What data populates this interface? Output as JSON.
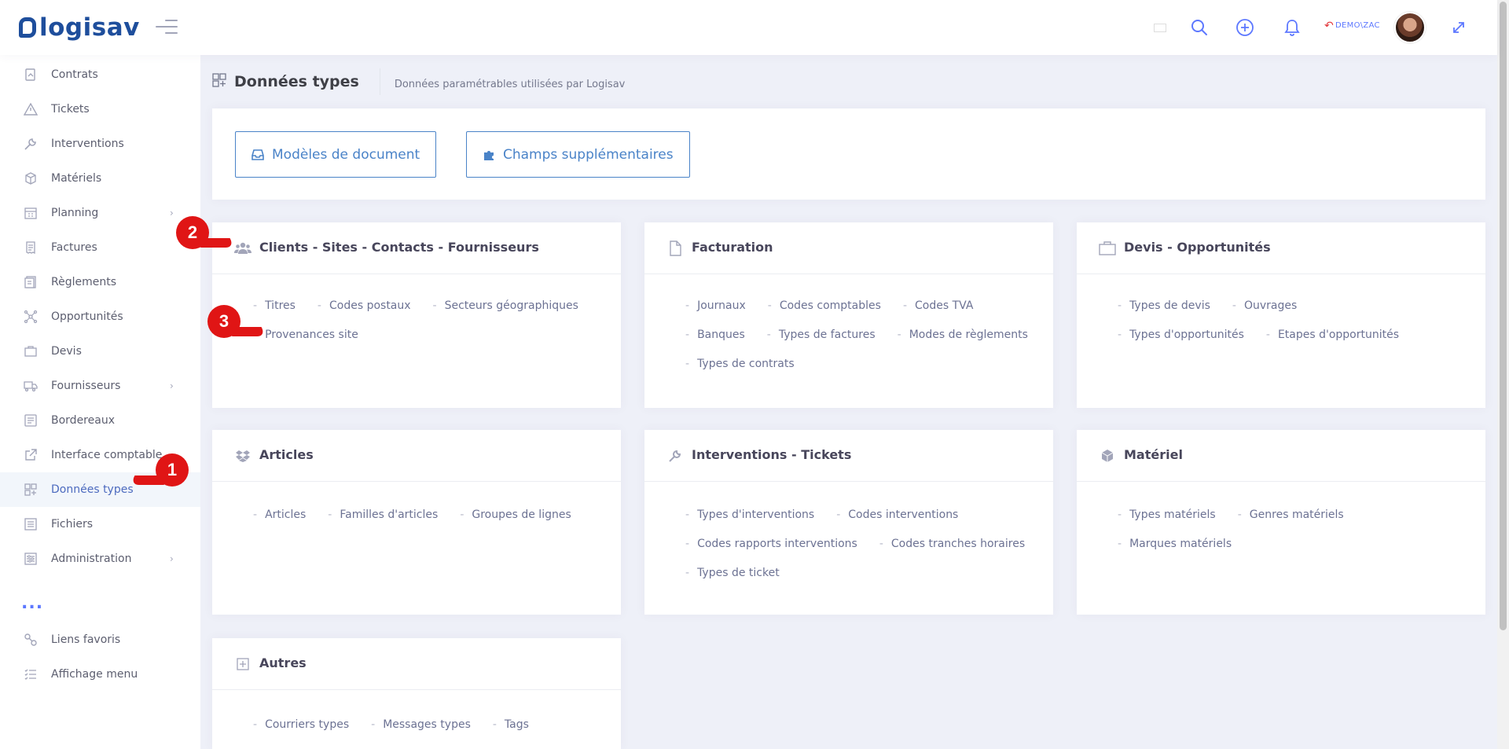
{
  "header": {
    "logo_text": "logisav",
    "user_label": "DEMO\\ZAC",
    "icons": [
      "menu-icon",
      "flag-fr-icon",
      "search-icon",
      "plus-circle-icon",
      "bell-icon",
      "undo-icon",
      "expand-icon"
    ]
  },
  "sidebar": {
    "items": [
      {
        "label": "Contrats",
        "icon": "contract-icon"
      },
      {
        "label": "Tickets",
        "icon": "warning-icon"
      },
      {
        "label": "Interventions",
        "icon": "wrench-icon"
      },
      {
        "label": "Matériels",
        "icon": "box-icon"
      },
      {
        "label": "Planning",
        "icon": "calendar-icon",
        "submenu": true
      },
      {
        "label": "Factures",
        "icon": "invoice-icon"
      },
      {
        "label": "Règlements",
        "icon": "payment-icon"
      },
      {
        "label": "Opportunités",
        "icon": "network-icon"
      },
      {
        "label": "Devis",
        "icon": "briefcase-icon"
      },
      {
        "label": "Fournisseurs",
        "icon": "truck-icon",
        "submenu": true
      },
      {
        "label": "Bordereaux",
        "icon": "list-icon"
      },
      {
        "label": "Interface comptable",
        "icon": "external-link-icon"
      },
      {
        "label": "Données types",
        "icon": "grid-icon",
        "active": true
      },
      {
        "label": "Fichiers",
        "icon": "folder-icon"
      },
      {
        "label": "Administration",
        "icon": "settings-icon",
        "submenu": true
      }
    ],
    "more": "...",
    "footer_items": [
      {
        "label": "Liens favoris",
        "icon": "link-icon"
      },
      {
        "label": "Affichage menu",
        "icon": "menu-list-icon"
      }
    ]
  },
  "subheader": {
    "title": "Données types",
    "description": "Données paramétrables utilisées par Logisav"
  },
  "buttons": {
    "models": "Modèles de document",
    "fields": "Champs supplémentaires"
  },
  "cards": {
    "clients": {
      "title": "Clients - Sites - Contacts - Fournisseurs",
      "rows": [
        [
          "Titres",
          "Codes postaux",
          "Secteurs géographiques"
        ],
        [
          "Provenances site"
        ]
      ]
    },
    "facturation": {
      "title": "Facturation",
      "rows": [
        [
          "Journaux",
          "Codes comptables",
          "Codes TVA"
        ],
        [
          "Banques",
          "Types de factures",
          "Modes de règlements"
        ],
        [
          "Types de contrats"
        ]
      ]
    },
    "devis": {
      "title": "Devis - Opportunités",
      "rows": [
        [
          "Types de devis",
          "Ouvrages"
        ],
        [
          "Types d'opportunités",
          "Etapes d'opportunités"
        ]
      ]
    },
    "articles": {
      "title": "Articles",
      "rows": [
        [
          "Articles",
          "Familles d'articles",
          "Groupes de lignes"
        ]
      ]
    },
    "interventions": {
      "title": "Interventions - Tickets",
      "rows": [
        [
          "Types d'interventions",
          "Codes interventions"
        ],
        [
          "Codes rapports interventions",
          "Codes tranches horaires"
        ],
        [
          "Types de ticket"
        ]
      ]
    },
    "materiel": {
      "title": "Matériel",
      "rows": [
        [
          "Types matériels",
          "Genres matériels"
        ],
        [
          "Marques matériels"
        ]
      ]
    },
    "autres": {
      "title": "Autres",
      "rows": [
        [
          "Courriers types",
          "Messages types",
          "Tags"
        ]
      ]
    }
  },
  "markers": [
    "1",
    "2",
    "3"
  ],
  "colors": {
    "accent": "#4a83c8",
    "brand": "#1e4e9c",
    "marker": "#e01515",
    "background": "#eef0f8"
  }
}
